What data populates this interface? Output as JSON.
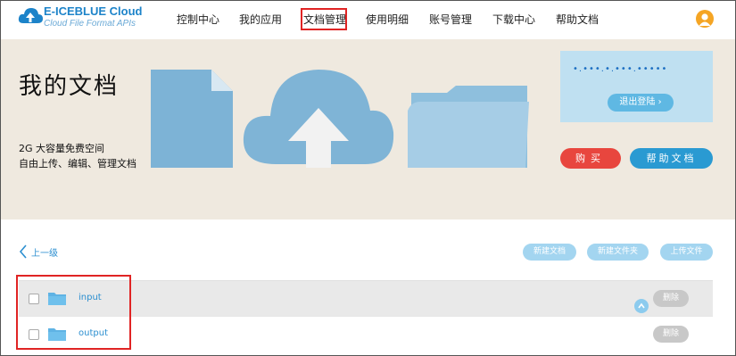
{
  "brand": {
    "name": "E-ICEBLUE Cloud",
    "tagline": "Cloud File Format APIs"
  },
  "nav": {
    "items": [
      "控制中心",
      "我的应用",
      "文档管理",
      "使用明细",
      "账号管理",
      "下载中心",
      "帮助文档"
    ],
    "active_index": 2
  },
  "banner": {
    "title": "我的文档",
    "line1": "2G 大容量免费空间",
    "line2": "自由上传、编辑、管理文档"
  },
  "user_panel": {
    "masked_account": "•.•••.•.•••.•••••",
    "logout_label": "退出登陆 ›"
  },
  "buttons": {
    "buy": "购买",
    "help": "帮助文档"
  },
  "toolbar": {
    "back_label": "上一级",
    "new_doc": "新建文档",
    "new_folder": "新建文件夹",
    "upload": "上传文件"
  },
  "files": [
    {
      "name": "input",
      "delete_label": "删除"
    },
    {
      "name": "output",
      "delete_label": "删除"
    }
  ],
  "colors": {
    "accent": "#2a9ad2",
    "danger": "#e8463e",
    "banner_bg": "#efe9df",
    "highlight_border": "#e02424"
  }
}
